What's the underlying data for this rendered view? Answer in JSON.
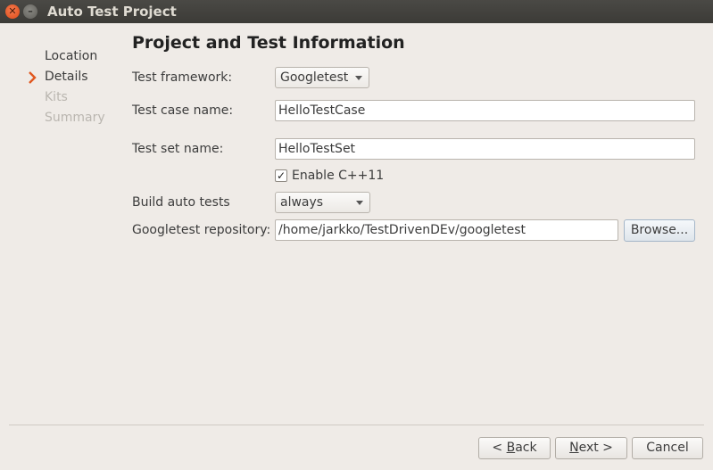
{
  "window": {
    "title": "Auto Test Project",
    "close_glyph": "✕",
    "minimize_glyph": "–"
  },
  "sidebar": {
    "arrow_icon": "chevron-right",
    "items": [
      {
        "label": "Location",
        "state": "done"
      },
      {
        "label": "Details",
        "state": "current"
      },
      {
        "label": "Kits",
        "state": "disabled"
      },
      {
        "label": "Summary",
        "state": "disabled"
      }
    ]
  },
  "page": {
    "heading": "Project and Test Information"
  },
  "form": {
    "framework_label": "Test framework:",
    "framework_value": "Googletest",
    "testcase_label": "Test case name:",
    "testcase_value": "HelloTestCase",
    "testset_label": "Test set name:",
    "testset_value": "HelloTestSet",
    "cpp11_label": "Enable C++11",
    "cpp11_checked": true,
    "cpp11_mark": "✓",
    "build_label": "Build auto tests",
    "build_value": "always",
    "repo_label": "Googletest repository:",
    "repo_value": "/home/jarkko/TestDrivenDEv/googletest",
    "browse_label": "Browse..."
  },
  "footer": {
    "back_prefix": "< ",
    "back_mnemonic": "B",
    "back_rest": "ack",
    "next_mnemonic": "N",
    "next_rest": "ext >",
    "cancel_label": "Cancel"
  },
  "colors": {
    "arrow": "#e0571f",
    "background": "#efebe7",
    "titlebar": "#3c3b37"
  }
}
